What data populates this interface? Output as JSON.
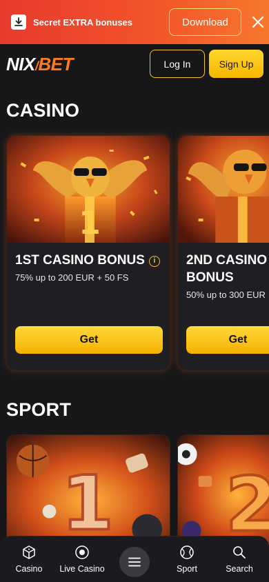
{
  "promo": {
    "text": "Secret EXTRA bonuses",
    "download_label": "Download",
    "icon": "download-icon"
  },
  "header": {
    "logo_left": "NIX",
    "logo_right": "BET",
    "login_label": "Log In",
    "signup_label": "Sign Up"
  },
  "casino": {
    "title": "CASINO",
    "cards": [
      {
        "title": "1ST CASINO BONUS",
        "desc": "75% up to 200 EUR + 50 FS",
        "button": "Get",
        "badge": "1"
      },
      {
        "title_line1": "2ND CASINO",
        "title_line2": "BONUS",
        "desc": "50% up to 300 EUR",
        "button": "Get"
      }
    ]
  },
  "sport": {
    "title": "SPORT",
    "cards": [
      {
        "badge": "1"
      },
      {
        "badge": "2"
      }
    ]
  },
  "bottom_nav": {
    "items": [
      {
        "label": "Casino",
        "icon": "dice-icon"
      },
      {
        "label": "Live Casino",
        "icon": "chip-icon"
      },
      {
        "label": "",
        "icon": "menu-icon"
      },
      {
        "label": "Sport",
        "icon": "ball-icon"
      },
      {
        "label": "Search",
        "icon": "search-icon"
      }
    ]
  },
  "colors": {
    "accent": "#f6c21a",
    "brand_orange": "#ff7a1a",
    "banner_red": "#e73a2e",
    "background": "#17171a"
  }
}
